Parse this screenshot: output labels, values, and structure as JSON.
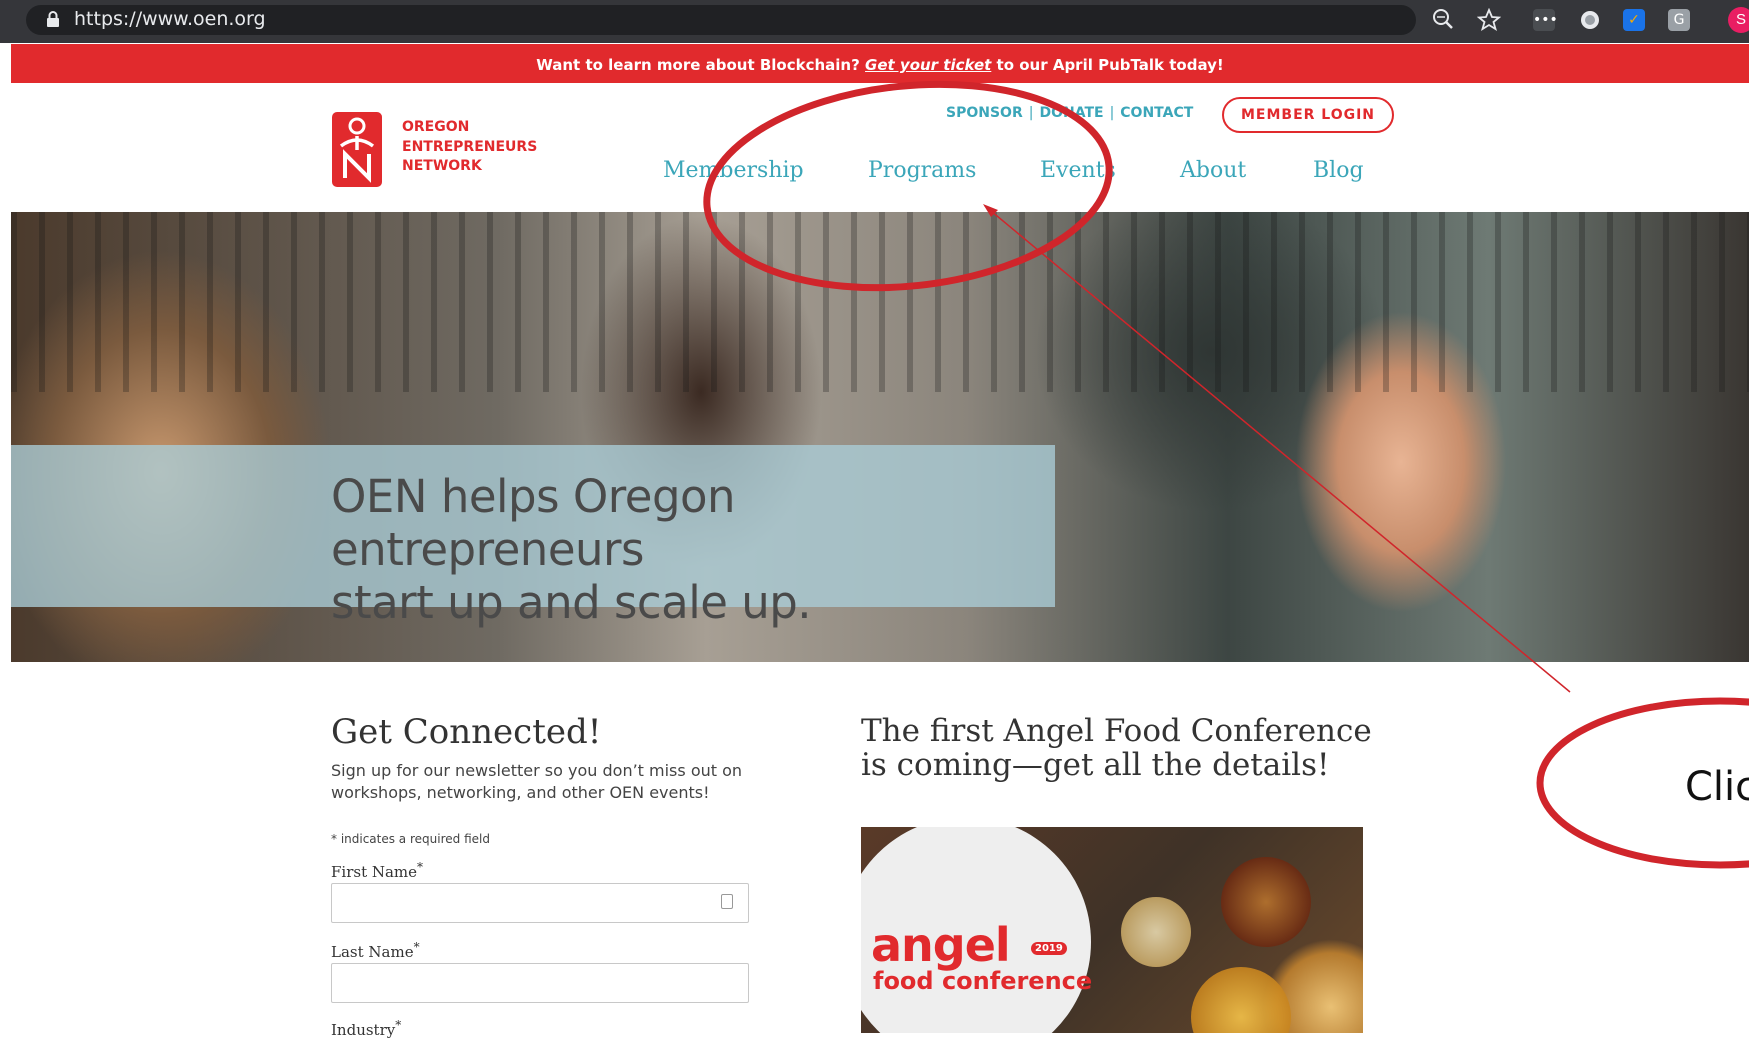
{
  "browser": {
    "url": "https://www.oen.org",
    "profile_initial": "S",
    "extension_g": "G"
  },
  "banner": {
    "before": "Want to learn more about Blockchain?",
    "link": "Get your ticket",
    "after": "to our April PubTalk today!",
    "color": "#e12a2d"
  },
  "header": {
    "logo_lines": [
      "OREGON",
      "ENTREPRENEURS",
      "NETWORK"
    ],
    "utility_links": [
      "SPONSOR",
      "DONATE",
      "CONTACT"
    ],
    "separator": "|",
    "login_label": "MEMBER LOGIN",
    "nav": [
      "Membership",
      "Programs",
      "Events",
      "About",
      "Blog"
    ],
    "accent_color": "#3ba6b9"
  },
  "hero": {
    "headline_line1": "OEN helps Oregon entrepreneurs",
    "headline_line2": "start up and scale up."
  },
  "signup": {
    "title": "Get Connected!",
    "description": "Sign up for our newsletter so you don’t miss out on workshops, networking, and other OEN events!",
    "required_note": "* indicates a required field",
    "fields": [
      {
        "label": "First Name",
        "required_mark": "*",
        "value": ""
      },
      {
        "label": "Last Name",
        "required_mark": "*",
        "value": ""
      },
      {
        "label": "Industry",
        "required_mark": "*"
      }
    ]
  },
  "article": {
    "title": "The first Angel Food Conference is coming—get all the details!",
    "image_word": "angel",
    "image_sub": "food conference",
    "image_year": "2019"
  },
  "annotation": {
    "partial_text": "Clic",
    "color": "#d0252b"
  }
}
